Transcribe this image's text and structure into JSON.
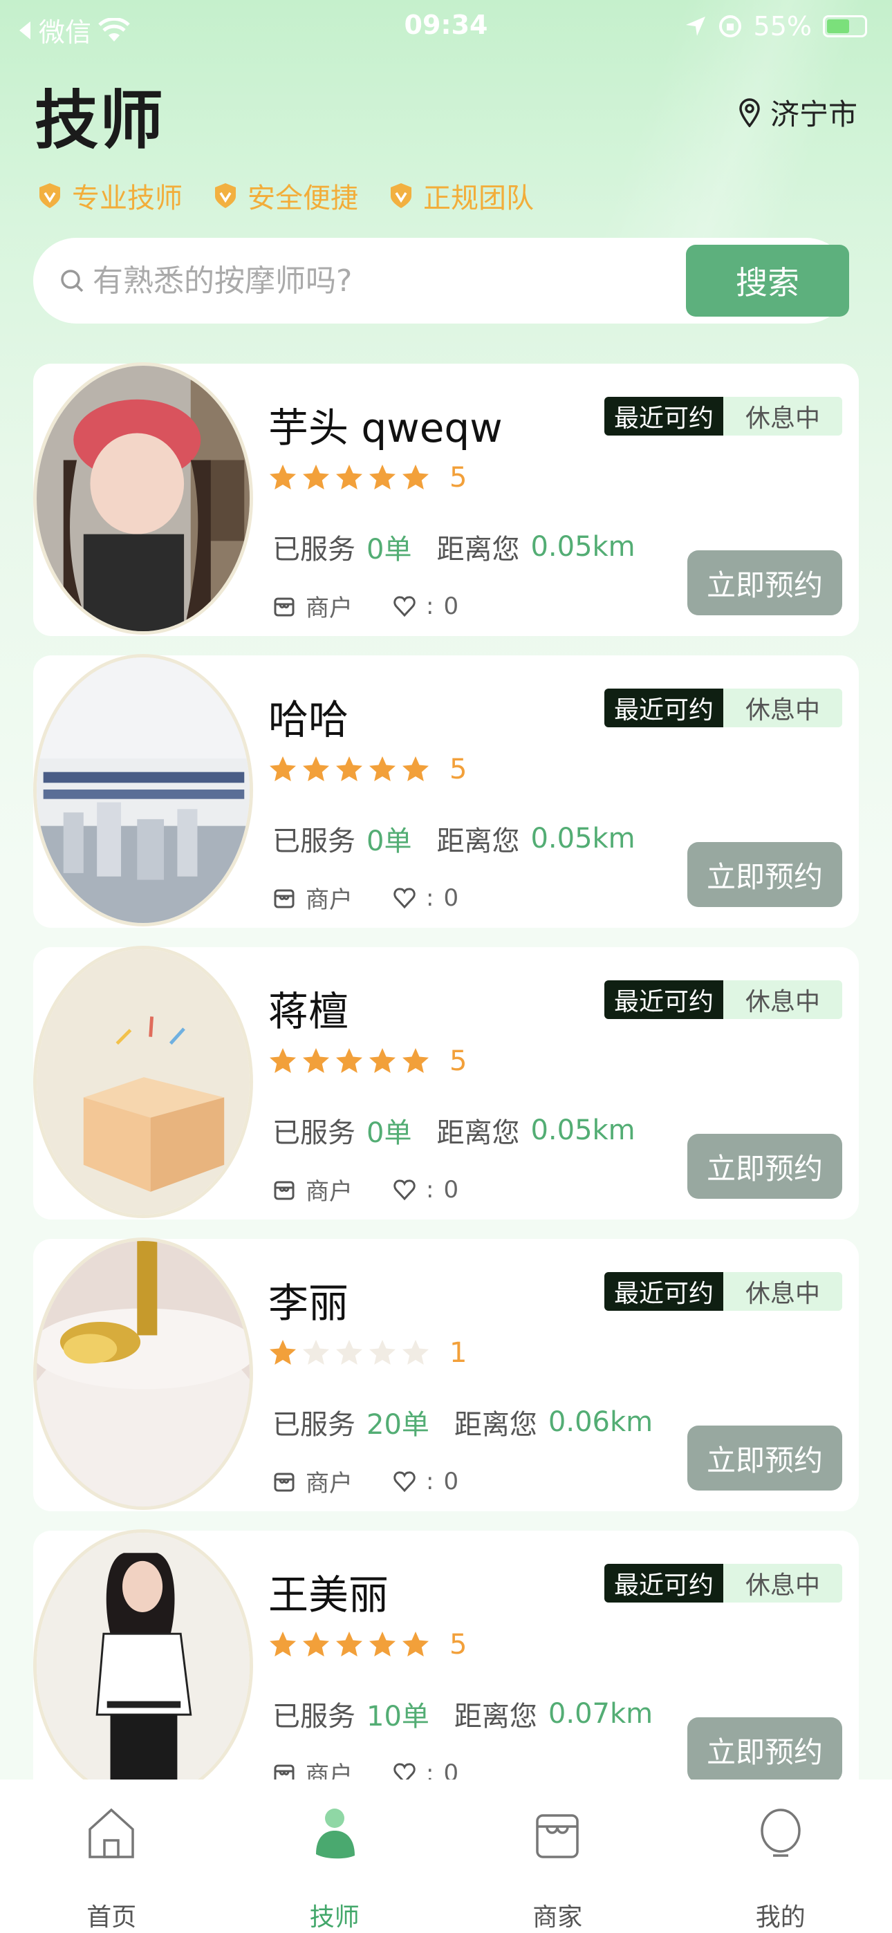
{
  "status_bar": {
    "carrier": "微信",
    "time": "09:34",
    "battery": "55%"
  },
  "header": {
    "title": "技师",
    "location": "济宁市",
    "tags": [
      "专业技师",
      "安全便捷",
      "正规团队"
    ]
  },
  "search": {
    "placeholder": "有熟悉的按摩师吗?",
    "button_label": "搜索"
  },
  "common": {
    "recent_label": "最近可约",
    "resting_label": "休息中",
    "served_label": "已服务",
    "distance_label": "距离您",
    "merchant_label": "商户",
    "like_sep": ":",
    "book_label": "立即预约"
  },
  "technicians": [
    {
      "name": "芋头 qweqw",
      "rating": 5,
      "score": "5",
      "served": "0单",
      "distance": "0.05km",
      "likes": "0"
    },
    {
      "name": "哈哈",
      "rating": 5,
      "score": "5",
      "served": "0单",
      "distance": "0.05km",
      "likes": "0"
    },
    {
      "name": "蒋檀",
      "rating": 5,
      "score": "5",
      "served": "0单",
      "distance": "0.05km",
      "likes": "0"
    },
    {
      "name": "李丽",
      "rating": 1,
      "score": "1",
      "served": "20单",
      "distance": "0.06km",
      "likes": "0"
    },
    {
      "name": "王美丽",
      "rating": 5,
      "score": "5",
      "served": "10单",
      "distance": "0.07km",
      "likes": "0"
    }
  ],
  "tabbar": {
    "items": [
      {
        "label": "首页",
        "icon": "home-icon"
      },
      {
        "label": "技师",
        "icon": "technician-icon"
      },
      {
        "label": "商家",
        "icon": "store-icon"
      },
      {
        "label": "我的",
        "icon": "profile-icon"
      }
    ],
    "active_index": 1
  },
  "colors": {
    "accent": "#5db07d",
    "star": "#f2a03a",
    "tag": "#f2ad3a",
    "book_button": "#98a8a0"
  }
}
